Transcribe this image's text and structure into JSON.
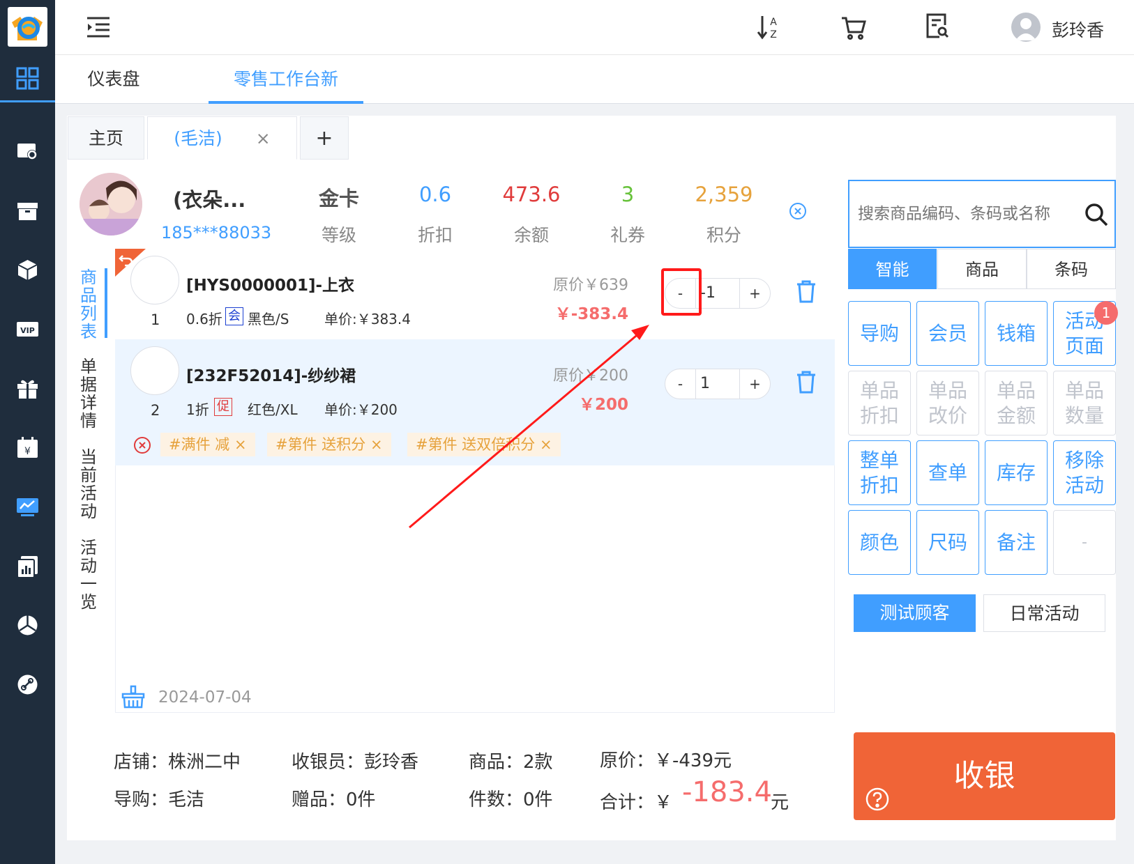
{
  "header": {
    "user_name": "彭玲香",
    "icons": [
      "menu-indent-icon",
      "sort-az-icon",
      "cart-icon",
      "search-doc-icon",
      "avatar-icon"
    ]
  },
  "sidebar": {
    "icons": [
      "dashboard-icon",
      "settings-monitor-icon",
      "package-icon",
      "cube-icon",
      "vip-icon",
      "gift-icon",
      "calendar-yen-icon",
      "chart-monitor-icon",
      "report-icon",
      "pie-chart-icon",
      "link-icon"
    ]
  },
  "nav_tabs": [
    {
      "label": "仪表盘"
    },
    {
      "label": "零售工作台新"
    }
  ],
  "inner_tabs": {
    "home": "主页",
    "customer": "(毛洁)",
    "close": "×",
    "add": "+"
  },
  "customer": {
    "name": "(衣朵...",
    "phone": "185***88033",
    "stats": [
      {
        "value": "金卡",
        "label": "等级"
      },
      {
        "value": "0.6",
        "label": "折扣"
      },
      {
        "value": "473.6",
        "label": "余额"
      },
      {
        "value": "3",
        "label": "礼券"
      },
      {
        "value": "2,359",
        "label": "积分"
      }
    ]
  },
  "side_tabs": [
    "商品列表",
    "单据详情",
    "当前活动",
    "活动一览"
  ],
  "products": [
    {
      "index": "1",
      "name": "[HYS0000001]-上衣",
      "discount": "0.6折",
      "badge": "会",
      "spec": "黑色/S",
      "unit_price": "单价:￥383.4",
      "orig_price": "原价￥639",
      "total": "￥-383.4",
      "qty": "-1",
      "minus": "-",
      "plus": "+"
    },
    {
      "index": "2",
      "name": "[232F52014]-纱纱裙",
      "discount": "1折",
      "badge": "促",
      "spec": "红色/XL",
      "unit_price": "单价:￥200",
      "orig_price": "原价￥200",
      "total": "￥200",
      "qty": "1",
      "minus": "-",
      "plus": "+",
      "tags": [
        "#满件 减 ×",
        "#第件 送积分 ×",
        "#第件 送双倍积分 ×"
      ]
    }
  ],
  "list_footer": {
    "date": "2024-07-04"
  },
  "search": {
    "placeholder": "搜索商品编码、条码或名称"
  },
  "search_modes": [
    "智能",
    "商品",
    "条码"
  ],
  "func_buttons": [
    {
      "label": "导购",
      "enabled": true
    },
    {
      "label": "会员",
      "enabled": true
    },
    {
      "label": "钱箱",
      "enabled": true
    },
    {
      "label": "活动页面",
      "enabled": true,
      "badge": "1"
    },
    {
      "label": "单品折扣",
      "enabled": false
    },
    {
      "label": "单品改价",
      "enabled": false
    },
    {
      "label": "单品金额",
      "enabled": false
    },
    {
      "label": "单品数量",
      "enabled": false
    },
    {
      "label": "整单折扣",
      "enabled": true
    },
    {
      "label": "查单",
      "enabled": true
    },
    {
      "label": "库存",
      "enabled": true
    },
    {
      "label": "移除活动",
      "enabled": true
    },
    {
      "label": "颜色",
      "enabled": true
    },
    {
      "label": "尺码",
      "enabled": true
    },
    {
      "label": "备注",
      "enabled": true
    },
    {
      "label": "-",
      "enabled": false
    }
  ],
  "category_tabs": [
    "测试顾客",
    "日常活动"
  ],
  "summary": {
    "store": "店铺：株洲二中",
    "cashier": "收银员：彭玲香",
    "goods": "商品：2款",
    "orig_label": "原价：￥-439元",
    "guide": "导购：毛洁",
    "gifts": "赠品：0件",
    "pieces": "件数：0件",
    "total_label": "合计：￥",
    "total_value": "-183.4",
    "total_unit": "元"
  },
  "checkout": {
    "label": "收银"
  },
  "colors": {
    "primary": "#409eff",
    "sidebar": "#1f2d3d",
    "price_red": "#f56c6c",
    "discount_blue": "#409eff",
    "balance_red": "#e03b3b",
    "coupon_green": "#67c23a",
    "points_orange": "#e6a23c",
    "checkout": "#f06437",
    "annotation_red": "#ff1a1a"
  }
}
